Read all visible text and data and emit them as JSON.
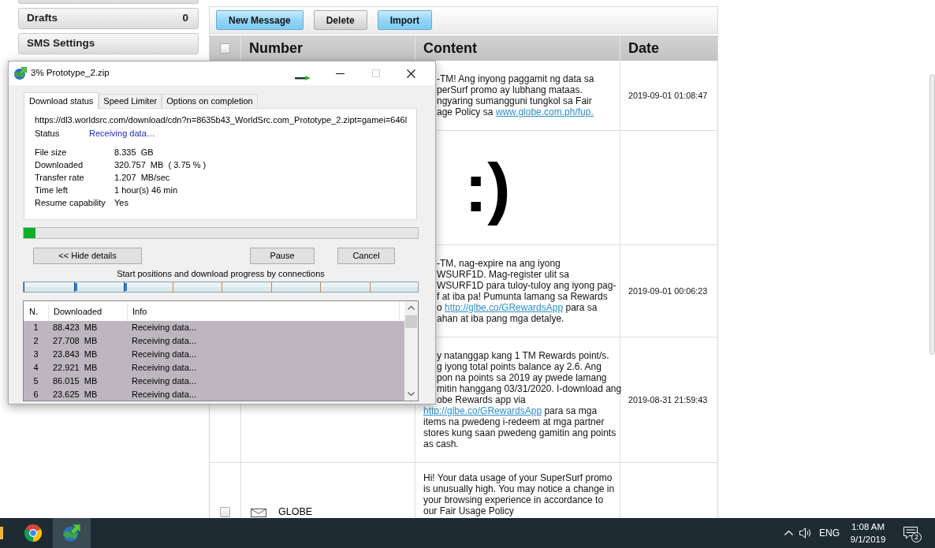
{
  "sidebar": {
    "items": [
      {
        "label": "Drafts",
        "count": "0"
      },
      {
        "label": "SMS Settings"
      }
    ]
  },
  "toolbar": {
    "buttons": [
      {
        "label": "New Message",
        "kind": "primary"
      },
      {
        "label": "Delete",
        "kind": "secondary"
      },
      {
        "label": "Import",
        "kind": "primary"
      }
    ]
  },
  "table": {
    "select_all": {
      "checked": false
    },
    "columns": [
      "Number",
      "Content",
      "Date"
    ],
    "rows": [
      {
        "content": {
          "kind": "text",
          "window_covered_lines": [
            {
              "text": "-TM! Ang inyong paggamit ng data sa"
            },
            {
              "text": "perSurf promo ay lubhang mataas."
            },
            {
              "text": "ngyaring sumangguni tungkol sa Fair"
            },
            {
              "text": "age Policy sa",
              "link": "www.globe.com.ph/fup."
            }
          ]
        },
        "date": "2019-09-01 01:08:47"
      },
      {
        "content": {
          "kind": "emoticon",
          "text": ":)"
        }
      },
      {
        "content": {
          "kind": "text",
          "window_covered_lines": [
            {
              "text": "-TM, nag-expire na ang iyong"
            },
            {
              "text": "WSURF1D. Mag-register ulit sa"
            },
            {
              "text": "WSURF1D para tuloy-tuloy ang iyong pag-"
            },
            {
              "text": "f at iba pa! Pumunta lamang sa Rewards"
            },
            {
              "text": "o",
              "link": "http://glbe.co/GRewardsApp",
              "after": "para sa"
            },
            {
              "text": "ahan at iba pang mga detalye."
            }
          ]
        },
        "date": "2019-09-01 00:06:23"
      },
      {
        "content": {
          "kind": "text",
          "window_covered_lines": [
            {
              "text": "y natanggap kang 1 TM Rewards point/s."
            },
            {
              "text": "g iyong total points balance ay 2.6. Ang"
            },
            {
              "text": "pon na points sa 2019 ay pwede lamang"
            },
            {
              "text": "mitin hanggang 03/31/2020. I-download ang"
            },
            {
              "text": "obe Rewards app via"
            }
          ],
          "lines": [
            {
              "link": "http://glbe.co/GRewardsApp",
              "after": "para sa mga"
            },
            {
              "text": "items na pwedeng i-redeem at mga partner"
            },
            {
              "text": "stores kung saan pwedeng gamitin ang points"
            },
            {
              "text": "as cash."
            }
          ]
        },
        "date": "2019-08-31 21:59:43"
      },
      {
        "checkbox": {
          "checked": false
        },
        "number": "GLOBE",
        "content": {
          "kind": "text",
          "lines": [
            {
              "text": "Hi! Your data usage of your SuperSurf promo"
            },
            {
              "text": "is unusually high. You may notice a change in"
            },
            {
              "text": "your browsing experience in accordance to"
            },
            {
              "text": "our Fair Usage Policy"
            }
          ]
        }
      }
    ]
  },
  "download_window": {
    "title": "3% Prototype_2.zip",
    "maximize_disabled": true,
    "tabs": [
      {
        "label": "Download status",
        "selected": true
      },
      {
        "label": "Speed Limiter",
        "selected": false
      },
      {
        "label": "Options on completion",
        "selected": false
      }
    ],
    "url": "https://dl3.worldsrc.com/download/cdn?n=8635b43_WorldSrc.com_Prototype_2.zipt=gamei=646l",
    "status": {
      "label": "Status",
      "value": "Receiving data…"
    },
    "details": [
      {
        "label": "File size",
        "value": "8.335  GB"
      },
      {
        "label": "Downloaded",
        "value": "320.757  MB  ( 3.75 % )"
      },
      {
        "label": "Transfer rate",
        "value": "1.207  MB/sec"
      },
      {
        "label": "Time left",
        "value": "1 hour(s) 46 min"
      },
      {
        "label": "Resume capability",
        "value": "Yes"
      }
    ],
    "progress": {
      "level": 0.03
    },
    "buttons": [
      "<< Hide details",
      "Pause",
      "Cancel"
    ],
    "connections_caption": "Start positions and download progress by connections",
    "connections": {
      "columns": [
        "N.",
        "Downloaded",
        "Info"
      ],
      "rows": [
        {
          "n": "1",
          "downloaded": "88.423  MB",
          "info": "Receiving data..."
        },
        {
          "n": "2",
          "downloaded": "27.708  MB",
          "info": "Receiving data..."
        },
        {
          "n": "3",
          "downloaded": "23.843  MB",
          "info": "Receiving data..."
        },
        {
          "n": "4",
          "downloaded": "22.921  MB",
          "info": "Receiving data..."
        },
        {
          "n": "5",
          "downloaded": "86.015  MB",
          "info": "Receiving data..."
        },
        {
          "n": "6",
          "downloaded": "23.625  MB",
          "info": "Receiving data..."
        }
      ]
    }
  },
  "taskbar": {
    "apps": [
      {
        "kind": "folder",
        "selected": false
      },
      {
        "kind": "browser",
        "selected": false
      },
      {
        "kind": "download_manager",
        "selected": true
      }
    ],
    "tray": {
      "language": "ENG",
      "time": "1:08 AM",
      "date": "9/1/2019",
      "notification_count": "2"
    }
  }
}
